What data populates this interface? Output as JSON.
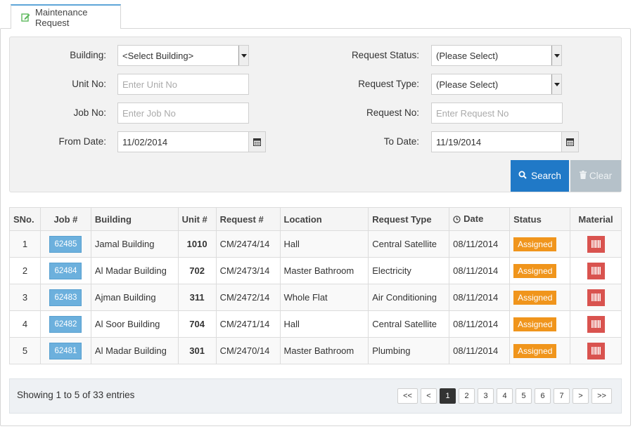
{
  "tab": {
    "label": "Maintenance Request"
  },
  "filters": {
    "building": {
      "label": "Building:",
      "value": "<Select Building>"
    },
    "request_status": {
      "label": "Request Status:",
      "value": "(Please Select)"
    },
    "unit_no": {
      "label": "Unit No:",
      "placeholder": "Enter Unit No"
    },
    "request_type": {
      "label": "Request Type:",
      "value": "(Please Select)"
    },
    "job_no": {
      "label": "Job No:",
      "placeholder": "Enter Job No"
    },
    "request_no": {
      "label": "Request No:",
      "placeholder": "Enter Request No"
    },
    "from_date": {
      "label": "From Date:",
      "value": "11/02/2014"
    },
    "to_date": {
      "label": "To Date:",
      "value": "11/19/2014"
    }
  },
  "buttons": {
    "search": "Search",
    "clear": "Clear"
  },
  "table": {
    "headers": {
      "sno": "SNo.",
      "job": "Job #",
      "building": "Building",
      "unit": "Unit #",
      "request": "Request #",
      "location": "Location",
      "request_type": "Request Type",
      "date": "Date",
      "status": "Status",
      "material": "Material"
    },
    "rows": [
      {
        "sno": "1",
        "job": "62485",
        "building": "Jamal Building",
        "unit": "1010",
        "request": "CM/2474/14",
        "location": "Hall",
        "type": "Central Satellite",
        "date": "08/11/2014",
        "status": "Assigned"
      },
      {
        "sno": "2",
        "job": "62484",
        "building": "Al Madar Building",
        "unit": "702",
        "request": "CM/2473/14",
        "location": "Master Bathroom",
        "type": "Electricity",
        "date": "08/11/2014",
        "status": "Assigned"
      },
      {
        "sno": "3",
        "job": "62483",
        "building": "Ajman Building",
        "unit": "311",
        "request": "CM/2472/14",
        "location": "Whole Flat",
        "type": "Air Conditioning",
        "date": "08/11/2014",
        "status": "Assigned"
      },
      {
        "sno": "4",
        "job": "62482",
        "building": "Al Soor Building",
        "unit": "704",
        "request": "CM/2471/14",
        "location": "Hall",
        "type": "Central Satellite",
        "date": "08/11/2014",
        "status": "Assigned"
      },
      {
        "sno": "5",
        "job": "62481",
        "building": "Al Madar Building",
        "unit": "301",
        "request": "CM/2470/14",
        "location": "Master Bathroom",
        "type": "Plumbing",
        "date": "08/11/2014",
        "status": "Assigned"
      }
    ]
  },
  "footer": {
    "showing": "Showing 1 to 5 of 33 entries",
    "pager": {
      "first": "<<",
      "prev": "<",
      "pages": [
        "1",
        "2",
        "3",
        "4",
        "5",
        "6",
        "7"
      ],
      "next": ">",
      "last": ">>",
      "active": "1"
    }
  },
  "colors": {
    "accent": "#2079c7",
    "status": "#f0951c",
    "job_badge": "#6cb0dd",
    "material": "#d9534f"
  }
}
